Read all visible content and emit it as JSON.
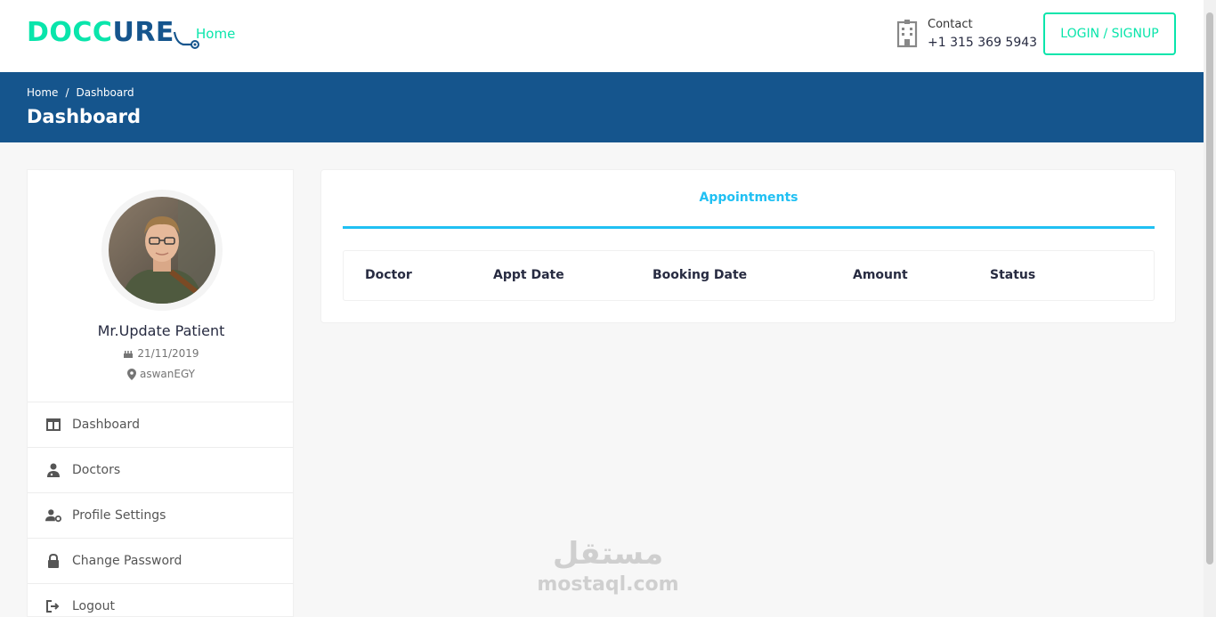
{
  "header": {
    "logo_part1": "DOCC",
    "logo_part2": "U",
    "logo_part3": "RE",
    "nav_home": "Home",
    "contact_label": "Contact",
    "contact_phone": "+1 315 369 5943",
    "login_label": "LOGIN / SIGNUP"
  },
  "breadcrumb": {
    "items": [
      "Home",
      "Dashboard"
    ],
    "separator": "/",
    "title": "Dashboard"
  },
  "profile": {
    "name": "Mr.Update Patient",
    "dob": "21/11/2019",
    "location": "aswanEGY"
  },
  "menu": [
    {
      "label": "Dashboard",
      "icon": "columns-icon"
    },
    {
      "label": "Doctors",
      "icon": "user-md-icon"
    },
    {
      "label": "Profile Settings",
      "icon": "user-cog-icon"
    },
    {
      "label": "Change Password",
      "icon": "lock-icon"
    },
    {
      "label": "Logout",
      "icon": "sign-out-icon"
    }
  ],
  "appointments": {
    "tab_label": "Appointments",
    "columns": [
      "Doctor",
      "Appt Date",
      "Booking Date",
      "Amount",
      "Status"
    ]
  },
  "watermark": {
    "arabic": "مستقل",
    "english": "mostaql.com"
  },
  "colors": {
    "brand_green": "#09e5ab",
    "brand_blue": "#15558d",
    "accent_cyan": "#20c0f3"
  }
}
